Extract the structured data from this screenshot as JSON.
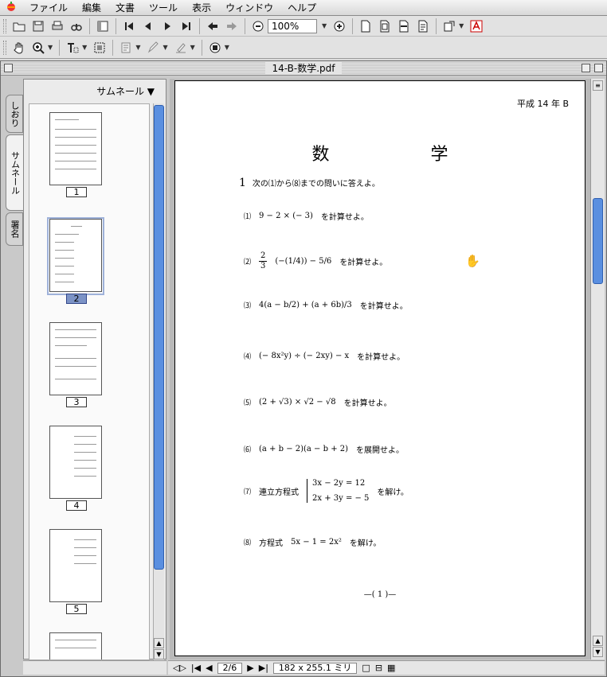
{
  "menubar": {
    "apple": "",
    "items": [
      "ファイル",
      "編集",
      "文書",
      "ツール",
      "表示",
      "ウィンドウ",
      "ヘルプ"
    ]
  },
  "toolbar": {
    "zoom_value": "100%"
  },
  "window": {
    "title": "14-B-数学.pdf"
  },
  "sidebar": {
    "tabs": [
      "しおり",
      "サムネール",
      "署名"
    ],
    "header": "サムネール ▼",
    "page_labels": [
      "1",
      "2",
      "3",
      "4",
      "5"
    ],
    "selected_page": "2"
  },
  "document": {
    "era_label": "平成 14 年 B",
    "title": "数 学",
    "instruction_num": "1",
    "instruction": "次の⑴から⑻までの問いに答えよ。",
    "questions": [
      {
        "num": "⑴",
        "expr": "9 − 2 × (− 3)",
        "suffix": "を計算せよ。"
      },
      {
        "num": "⑵",
        "expr": "(−(1/4)) − 5/6",
        "suffix": "を計算せよ。"
      },
      {
        "num": "⑶",
        "expr": "4(a − b/2) + (a + 6b)/3",
        "suffix": "を計算せよ。"
      },
      {
        "num": "⑷",
        "expr": "(− 8x²y) ÷ (− 2xy) − x",
        "suffix": "を計算せよ。"
      },
      {
        "num": "⑸",
        "expr": "(2 + √3) × √2 − √8",
        "suffix": "を計算せよ。"
      },
      {
        "num": "⑹",
        "expr": "(a + b − 2)(a − b + 2)",
        "suffix": "を展開せよ。"
      },
      {
        "num": "⑺",
        "label": "連立方程式",
        "eq1": "3x − 2y = 12",
        "eq2": "2x + 3y = − 5",
        "suffix": "を解け。"
      },
      {
        "num": "⑻",
        "label": "方程式",
        "expr": "5x − 1 = 2x²",
        "suffix": "を解け。"
      }
    ],
    "footer": "—( 1 )—"
  },
  "status": {
    "page_indicator": "2/6",
    "page_size": "182 x 255.1 ミリ"
  }
}
